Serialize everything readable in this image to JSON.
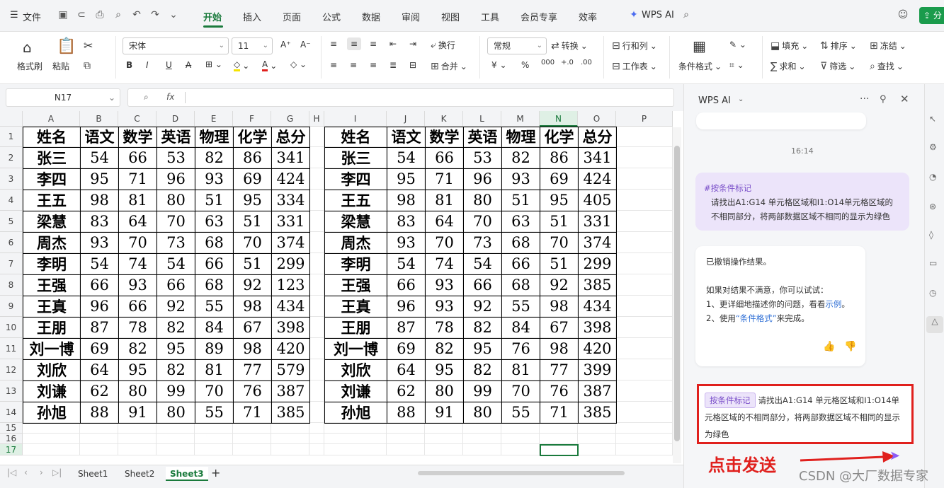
{
  "menu": {
    "file": "文件",
    "tabs": [
      "开始",
      "插入",
      "页面",
      "公式",
      "数据",
      "审阅",
      "视图",
      "工具",
      "会员专享",
      "效率"
    ],
    "active_tab": "开始",
    "wps_ai": "WPS AI"
  },
  "ribbon": {
    "format_painter": "格式刷",
    "paste": "粘贴",
    "font_name": "宋体",
    "font_size": "11",
    "wrap": "换行",
    "merge": "合并",
    "number_format": "常规",
    "convert": "转换",
    "row_col": "行和列",
    "worksheet": "工作表",
    "cond_format": "条件格式",
    "fill": "填充",
    "sort": "排序",
    "freeze": "冻结",
    "sum": "求和",
    "filter": "筛选",
    "find": "查找"
  },
  "formula_bar": {
    "name_box": "N17",
    "fx": "fx"
  },
  "columns": [
    "A",
    "B",
    "C",
    "D",
    "E",
    "F",
    "G",
    "H",
    "I",
    "J",
    "K",
    "L",
    "M",
    "N",
    "O",
    "P"
  ],
  "selected_column": "N",
  "rows": [
    "1",
    "2",
    "3",
    "4",
    "5",
    "6",
    "7",
    "8",
    "9",
    "10",
    "11",
    "12",
    "13",
    "14",
    "15",
    "16",
    "17"
  ],
  "selected_row": "17",
  "table_left": {
    "header": [
      "姓名",
      "语文",
      "数学",
      "英语",
      "物理",
      "化学",
      "总分"
    ],
    "data": [
      [
        "张三",
        "54",
        "66",
        "53",
        "82",
        "86",
        "341"
      ],
      [
        "李四",
        "95",
        "71",
        "96",
        "93",
        "69",
        "424"
      ],
      [
        "王五",
        "98",
        "81",
        "80",
        "51",
        "95",
        "334"
      ],
      [
        "梁慧",
        "83",
        "64",
        "70",
        "63",
        "51",
        "331"
      ],
      [
        "周杰",
        "93",
        "70",
        "73",
        "68",
        "70",
        "374"
      ],
      [
        "李明",
        "54",
        "74",
        "54",
        "66",
        "51",
        "299"
      ],
      [
        "王强",
        "66",
        "93",
        "66",
        "68",
        "92",
        "123"
      ],
      [
        "王真",
        "96",
        "66",
        "92",
        "55",
        "98",
        "434"
      ],
      [
        "王朋",
        "87",
        "78",
        "82",
        "84",
        "67",
        "398"
      ],
      [
        "刘一博",
        "69",
        "82",
        "95",
        "89",
        "98",
        "420"
      ],
      [
        "刘欣",
        "64",
        "95",
        "82",
        "81",
        "77",
        "579"
      ],
      [
        "刘谦",
        "62",
        "80",
        "99",
        "70",
        "76",
        "387"
      ],
      [
        "孙旭",
        "88",
        "91",
        "80",
        "55",
        "71",
        "385"
      ]
    ]
  },
  "table_right": {
    "header": [
      "姓名",
      "语文",
      "数学",
      "英语",
      "物理",
      "化学",
      "总分"
    ],
    "data": [
      [
        "张三",
        "54",
        "66",
        "53",
        "82",
        "86",
        "341"
      ],
      [
        "李四",
        "95",
        "71",
        "96",
        "93",
        "69",
        "424"
      ],
      [
        "王五",
        "98",
        "81",
        "80",
        "51",
        "95",
        "405"
      ],
      [
        "梁慧",
        "83",
        "64",
        "70",
        "63",
        "51",
        "331"
      ],
      [
        "周杰",
        "93",
        "70",
        "73",
        "68",
        "70",
        "374"
      ],
      [
        "李明",
        "54",
        "74",
        "54",
        "66",
        "51",
        "299"
      ],
      [
        "王强",
        "66",
        "93",
        "66",
        "68",
        "92",
        "385"
      ],
      [
        "王真",
        "96",
        "93",
        "92",
        "55",
        "98",
        "434"
      ],
      [
        "王朋",
        "87",
        "78",
        "82",
        "84",
        "67",
        "398"
      ],
      [
        "刘一博",
        "69",
        "82",
        "95",
        "76",
        "98",
        "420"
      ],
      [
        "刘欣",
        "64",
        "95",
        "82",
        "81",
        "77",
        "399"
      ],
      [
        "刘谦",
        "62",
        "80",
        "99",
        "70",
        "76",
        "387"
      ],
      [
        "孙旭",
        "88",
        "91",
        "80",
        "55",
        "71",
        "385"
      ]
    ]
  },
  "sheets": [
    "Sheet1",
    "Sheet2",
    "Sheet3"
  ],
  "active_sheet": "Sheet3",
  "ai_panel": {
    "title": "WPS AI",
    "time": "16:14",
    "user_tag": "#按条件标记",
    "user_text": "请找出A1:G14 单元格区域和I1:O14单元格区域的不相同部分，将两部数据区域不相同的显示为绿色",
    "reply_line1": "已撤销操作结果。",
    "reply_line2": "如果对结果不满意，你可以试试：",
    "reply_line3_pre": "1、更详细地描述你的问题，看看",
    "reply_line3_link": "示例",
    "reply_line3_post": "。",
    "reply_line4_pre": "2、使用",
    "reply_line4_link": "“条件格式”",
    "reply_line4_post": "来完成。",
    "input_tag": "按条件标记",
    "input_text": "请找出A1:G14 单元格区域和I1:O14单元格区域的不相同部分，将两部数据区域不相同的显示为绿色",
    "annotation": "点击发送"
  },
  "watermark": "CSDN @大厂数据专家",
  "colors": {
    "accent": "#1a7a3c",
    "highlight": "#e0201d",
    "ai_purple": "#7a4fc9"
  }
}
